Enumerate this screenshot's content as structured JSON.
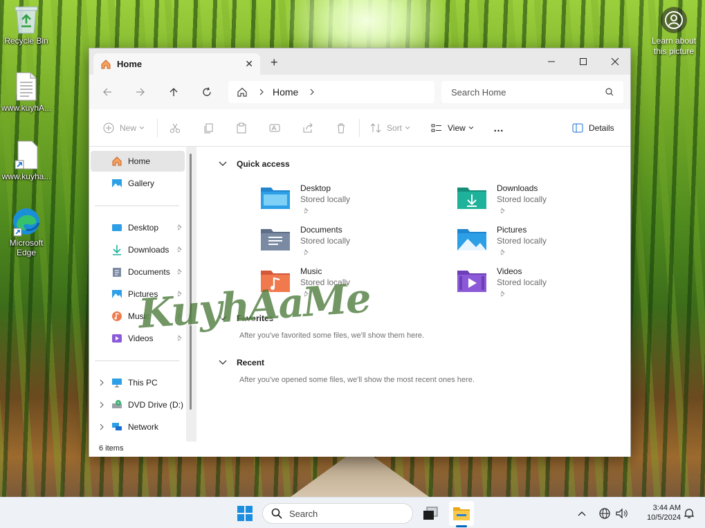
{
  "desktop": {
    "icons": [
      {
        "label": "Recycle Bin"
      },
      {
        "label": "www.kuyhA..."
      },
      {
        "label": "www.kuyha..."
      },
      {
        "label": "Microsoft Edge"
      }
    ],
    "learn_label": "Learn about this picture"
  },
  "explorer": {
    "tab_title": "Home",
    "tab_new": "+",
    "breadcrumb": "Home",
    "search_placeholder": "Search Home",
    "toolbar": {
      "new_label": "New",
      "sort_label": "Sort",
      "view_label": "View",
      "more_label": "…",
      "details_label": "Details"
    },
    "sidebar": {
      "top": [
        {
          "label": "Home"
        },
        {
          "label": "Gallery"
        }
      ],
      "pinned": [
        {
          "label": "Desktop"
        },
        {
          "label": "Downloads"
        },
        {
          "label": "Documents"
        },
        {
          "label": "Pictures"
        },
        {
          "label": "Music"
        },
        {
          "label": "Videos"
        }
      ],
      "drives": [
        {
          "label": "This PC"
        },
        {
          "label": "DVD Drive (D:) C"
        },
        {
          "label": "Network"
        }
      ]
    },
    "quick_access": {
      "header": "Quick access",
      "items": [
        {
          "name": "Desktop",
          "sub": "Stored locally"
        },
        {
          "name": "Downloads",
          "sub": "Stored locally"
        },
        {
          "name": "Documents",
          "sub": "Stored locally"
        },
        {
          "name": "Pictures",
          "sub": "Stored locally"
        },
        {
          "name": "Music",
          "sub": "Stored locally"
        },
        {
          "name": "Videos",
          "sub": "Stored locally"
        }
      ]
    },
    "favorites": {
      "header": "Favorites",
      "message": "After you've favorited some files, we'll show them here."
    },
    "recent": {
      "header": "Recent",
      "message": "After you've opened some files, we'll show the most recent ones here."
    },
    "status": "6 items"
  },
  "watermark": "KuyhAaMe",
  "taskbar": {
    "search_label": "Search",
    "time": "3:44 AM",
    "date": "10/5/2024"
  },
  "colors": {
    "accent": "#0067c0",
    "folder_blue": "#2d9fe6",
    "folder_teal": "#1fb29a",
    "folder_slate": "#7a8aa3",
    "folder_orange": "#f07a4e",
    "folder_purple": "#8c5ad8"
  }
}
